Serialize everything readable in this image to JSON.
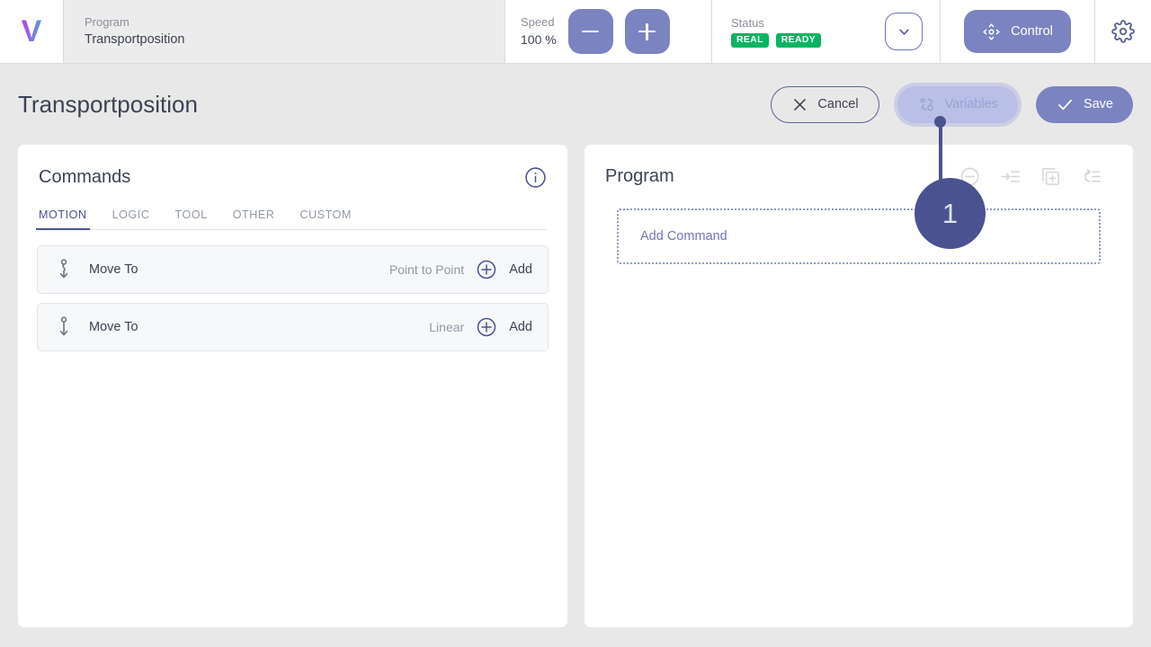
{
  "topbar": {
    "logo_text": "V",
    "program": {
      "label": "Program",
      "value": "Transportposition"
    },
    "speed": {
      "label": "Speed",
      "value": "100 %",
      "decrease_icon": "minus-icon",
      "increase_icon": "plus-icon"
    },
    "status": {
      "label": "Status",
      "badges": [
        "REAL",
        "READY"
      ],
      "chevron_icon": "chevron-down-icon"
    },
    "control": {
      "label": "Control",
      "icon": "move-joystick-icon"
    },
    "settings_icon": "gear-icon"
  },
  "page": {
    "title": "Transportposition",
    "actions": {
      "cancel": {
        "label": "Cancel",
        "icon": "close-icon"
      },
      "variables": {
        "label": "Variables",
        "icon": "variables-icon"
      },
      "save": {
        "label": "Save",
        "icon": "check-icon"
      }
    }
  },
  "tour": {
    "step_number": "1"
  },
  "commands_panel": {
    "title": "Commands",
    "info_icon": "info-icon",
    "tabs": [
      {
        "label": "MOTION",
        "active": true
      },
      {
        "label": "LOGIC",
        "active": false
      },
      {
        "label": "TOOL",
        "active": false
      },
      {
        "label": "OTHER",
        "active": false
      },
      {
        "label": "CUSTOM",
        "active": false
      }
    ],
    "items": [
      {
        "name": "Move To",
        "mode": "Point to Point",
        "add_label": "Add",
        "icon": "move-point-to-point-icon",
        "add_icon": "plus-circle-icon"
      },
      {
        "name": "Move To",
        "mode": "Linear",
        "add_label": "Add",
        "icon": "move-linear-icon",
        "add_icon": "plus-circle-icon"
      }
    ]
  },
  "program_panel": {
    "title": "Program",
    "tools": [
      {
        "name": "minus-circle-icon"
      },
      {
        "name": "insert-into-list-icon"
      },
      {
        "name": "duplicate-add-icon"
      },
      {
        "name": "loop-list-icon"
      }
    ],
    "dropzone_label": "Add Command"
  },
  "colors": {
    "accent": "#7b84c0",
    "accent_dark": "#4a538f",
    "status_green": "#08b463",
    "page_bg": "#e8e8e8",
    "text": "#3c4353",
    "muted": "#9299a5"
  }
}
